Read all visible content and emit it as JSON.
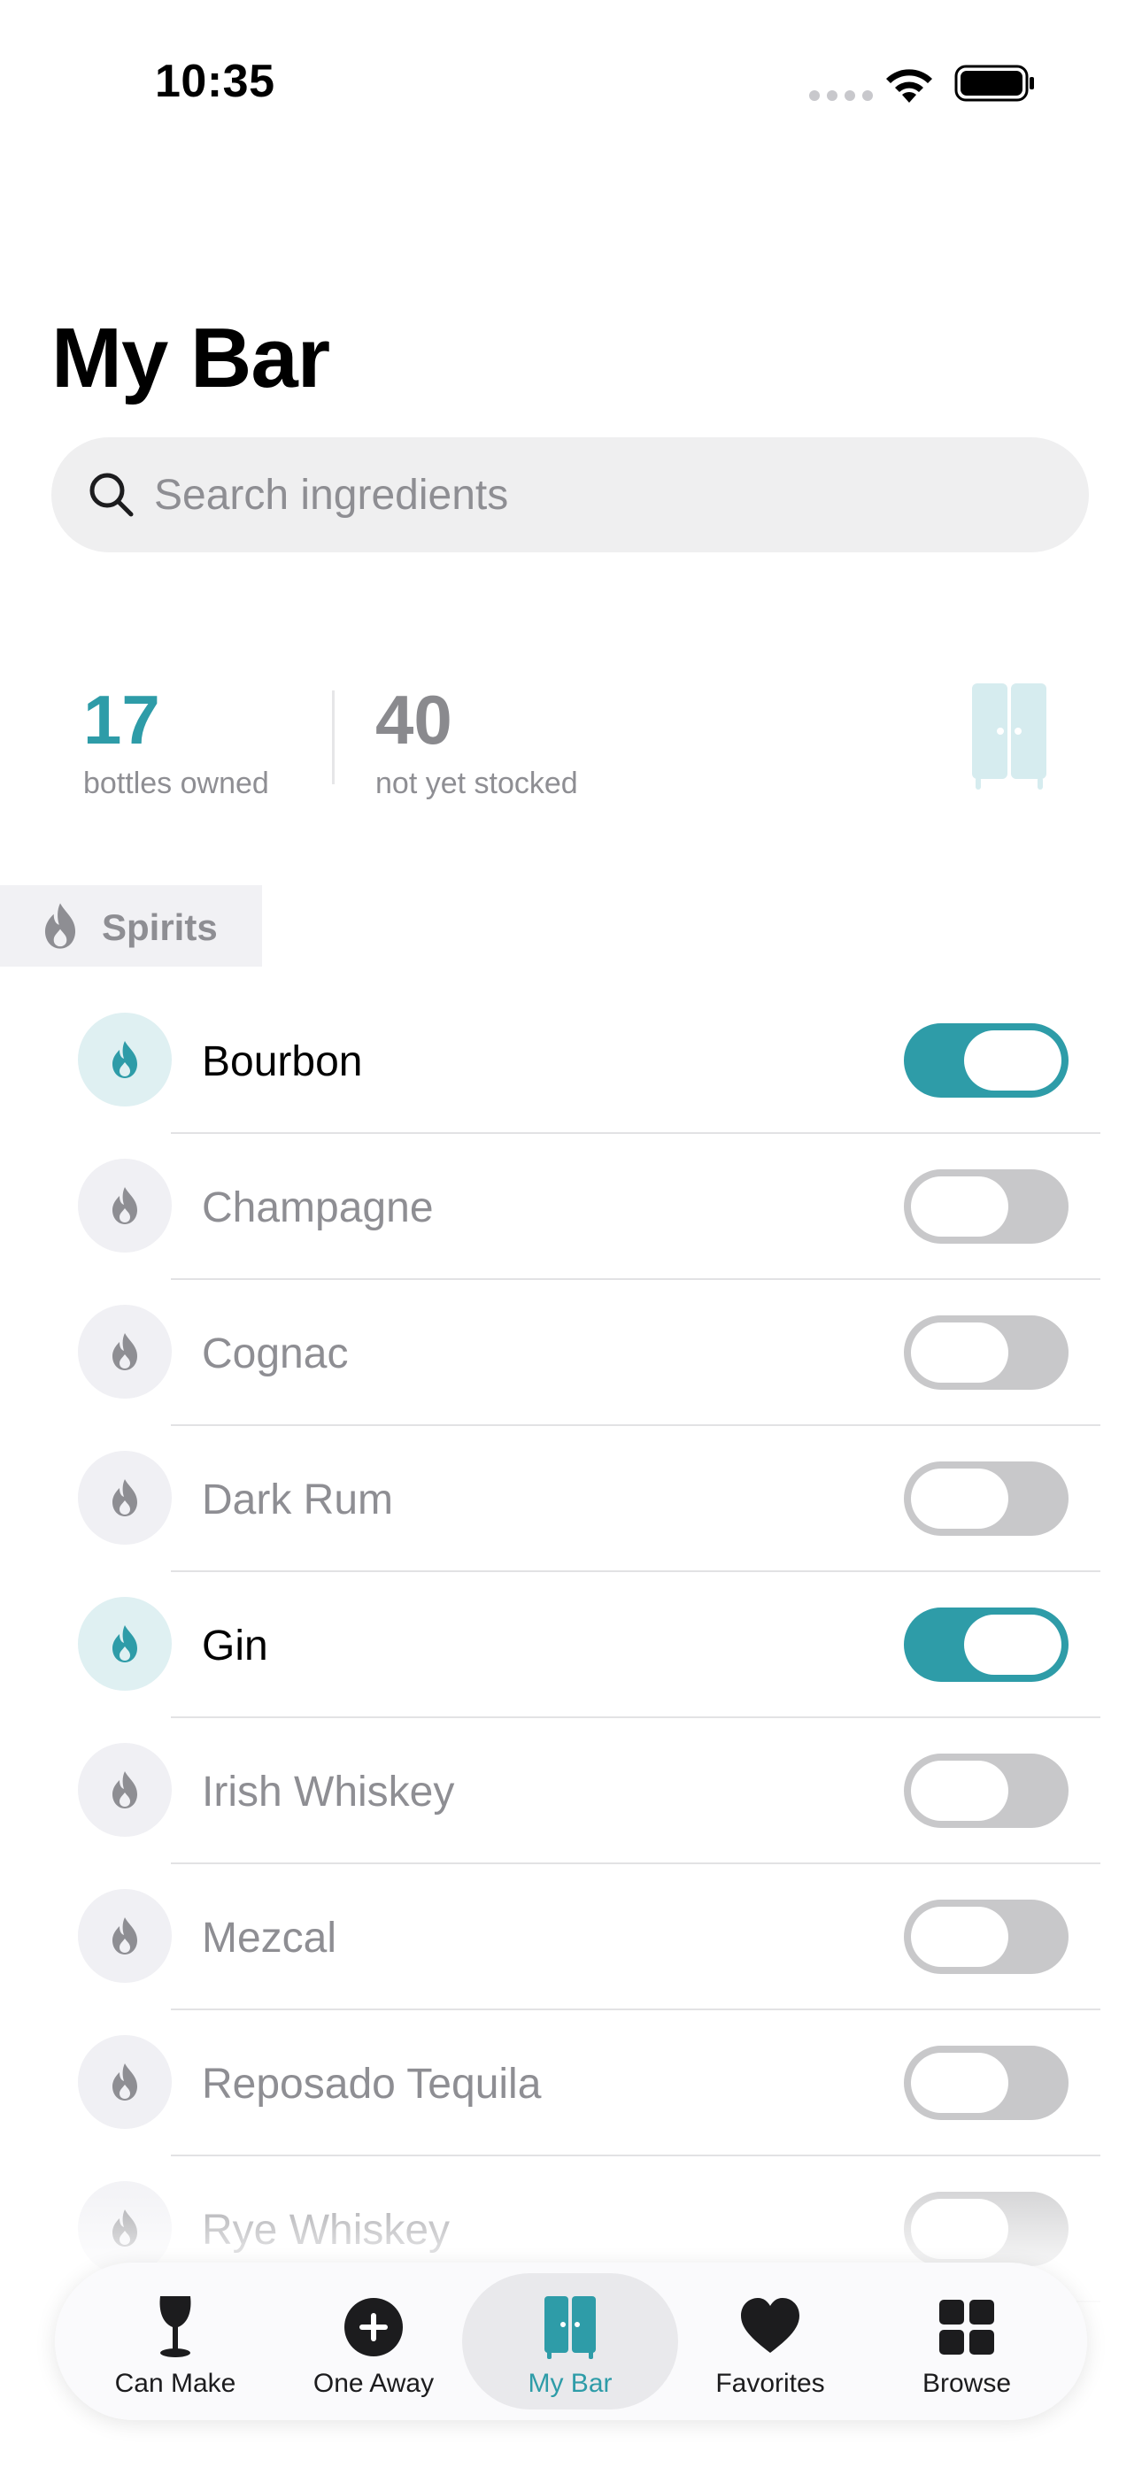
{
  "status_bar": {
    "time": "10:35"
  },
  "page": {
    "title": "My Bar"
  },
  "search": {
    "placeholder": "Search ingredients"
  },
  "stats": {
    "owned_count": "17",
    "owned_label": "bottles owned",
    "stock_count": "40",
    "stock_label": "not yet stocked"
  },
  "section": {
    "label": "Spirits"
  },
  "colors": {
    "accent": "#2e9ca8",
    "muted": "#8e8e93",
    "toggle_off": "#c8c8ca"
  },
  "ingredients": [
    {
      "label": "Bourbon",
      "owned": true
    },
    {
      "label": "Champagne",
      "owned": false
    },
    {
      "label": "Cognac",
      "owned": false
    },
    {
      "label": "Dark Rum",
      "owned": false
    },
    {
      "label": "Gin",
      "owned": true
    },
    {
      "label": "Irish Whiskey",
      "owned": false
    },
    {
      "label": "Mezcal",
      "owned": false
    },
    {
      "label": "Reposado Tequila",
      "owned": false
    },
    {
      "label": "Rye Whiskey",
      "owned": false
    }
  ],
  "tab_bar": {
    "tabs": [
      {
        "label": "Can Make",
        "icon": "wine-glass-icon",
        "active": false
      },
      {
        "label": "One Away",
        "icon": "plus-circle-icon",
        "active": false
      },
      {
        "label": "My Bar",
        "icon": "cabinet-icon",
        "active": true
      },
      {
        "label": "Favorites",
        "icon": "heart-icon",
        "active": false
      },
      {
        "label": "Browse",
        "icon": "grid-icon",
        "active": false
      }
    ]
  }
}
